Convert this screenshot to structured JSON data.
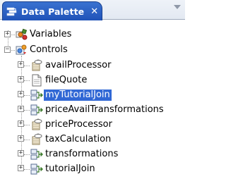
{
  "view": {
    "title": "Data Palette",
    "close_glyph": "✕"
  },
  "tree": {
    "groups": [
      {
        "label": "Variables",
        "icon": "variables-icon",
        "expanded": false,
        "expander": "+"
      },
      {
        "label": "Controls",
        "icon": "controls-icon",
        "expanded": true,
        "expander": "−"
      }
    ],
    "controls": [
      {
        "label": "availProcessor",
        "icon": "java-processor-icon",
        "expander": "+"
      },
      {
        "label": "fileQuote",
        "icon": "document-icon",
        "expander": "+"
      },
      {
        "label": "myTutorialJoin",
        "icon": "join-icon",
        "expander": "+",
        "selected": true
      },
      {
        "label": "priceAvailTransformations",
        "icon": "join-icon",
        "expander": "+"
      },
      {
        "label": "priceProcessor",
        "icon": "java-processor-icon",
        "expander": "+"
      },
      {
        "label": "taxCalculation",
        "icon": "java-processor-icon",
        "expander": "+"
      },
      {
        "label": "transformations",
        "icon": "join-icon",
        "expander": "+"
      },
      {
        "label": "tutorialJoin",
        "icon": "join-icon",
        "expander": "+"
      }
    ]
  },
  "colors": {
    "tab_active": "#2a5fc4",
    "selection": "#3168d5"
  }
}
